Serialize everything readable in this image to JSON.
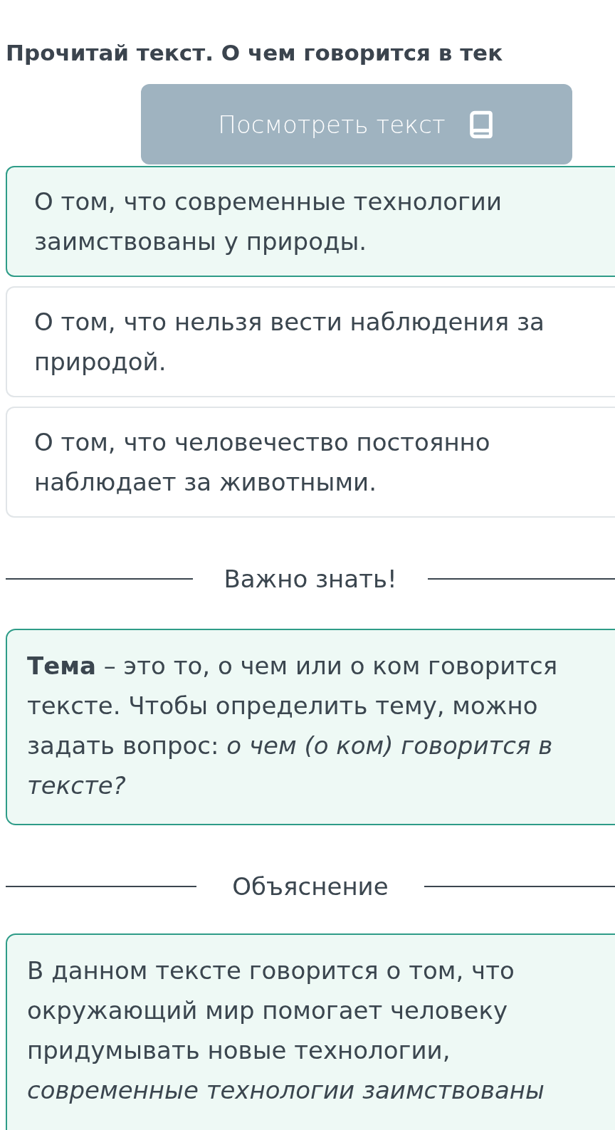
{
  "question": {
    "title": "Прочитай текст. О чем говорится в тек"
  },
  "view_text_button": {
    "label": "Посмотреть текст"
  },
  "options": [
    {
      "text": "О том, что современные технологии заимствованы у природы.",
      "selected": true
    },
    {
      "text": "О том, что нельзя вести наблюдения за природой.",
      "selected": false
    },
    {
      "text": "О том, что человечество постоянно наблюдает за животными.",
      "selected": false
    }
  ],
  "important": {
    "heading": "Важно знать!",
    "text": "**Тема** – это то, о чем или о ком говорится тексте. Чтобы определить тему, можно задать вопрос: *о чем (о ком) говорится в тексте?*"
  },
  "explanation": {
    "heading": "Объяснение",
    "text": "В данном тексте говорится о том, что окружающий мир помогает человеку придумывать новые технологии, *современные технологии заимствованы*"
  }
}
